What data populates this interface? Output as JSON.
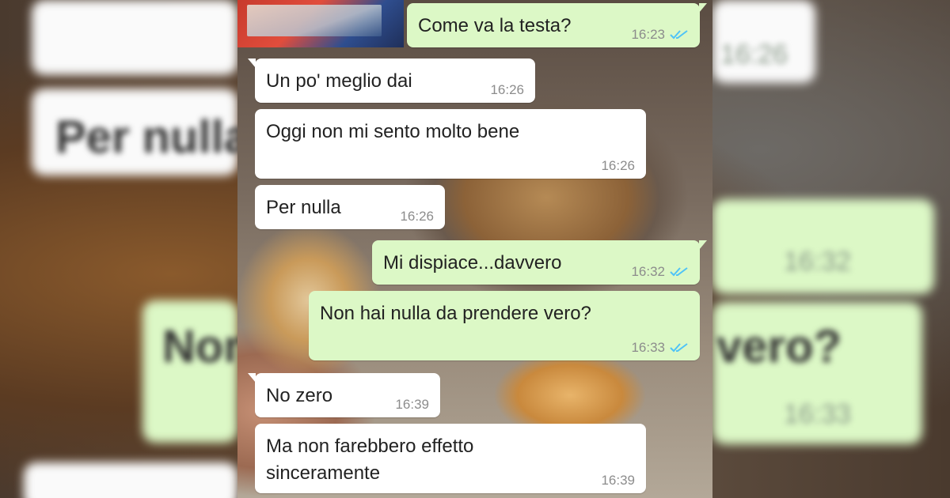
{
  "colors": {
    "incoming_bubble": "#ffffff",
    "outgoing_bubble": "#dcf8c6",
    "read_ticks": "#4fc3f7",
    "timestamp": "#8c8c8c"
  },
  "messages": [
    {
      "direction": "out",
      "text": "Come va la testa?",
      "time": "16:23",
      "status": "read-ticks-icon"
    },
    {
      "direction": "in",
      "text": "Un po' meglio dai",
      "time": "16:26"
    },
    {
      "direction": "in",
      "text": "Oggi non mi sento molto bene",
      "time": "16:26"
    },
    {
      "direction": "in",
      "text": "Per nulla",
      "time": "16:26"
    },
    {
      "direction": "out",
      "text": "Mi dispiace...davvero",
      "time": "16:32",
      "status": "read-ticks-icon"
    },
    {
      "direction": "out",
      "text": "Non hai nulla da prendere vero?",
      "time": "16:33",
      "status": "read-ticks-icon"
    },
    {
      "direction": "in",
      "text": "No zero",
      "time": "16:39"
    },
    {
      "direction": "in",
      "text": "Ma non farebbero effetto\nsinceramente",
      "time": "16:39"
    }
  ],
  "backdrop": {
    "left_texts": [
      "Per nulla",
      "Non"
    ],
    "right_texts": [
      "vero?"
    ],
    "right_times": [
      "16:26",
      "16:32",
      "16:33"
    ]
  }
}
